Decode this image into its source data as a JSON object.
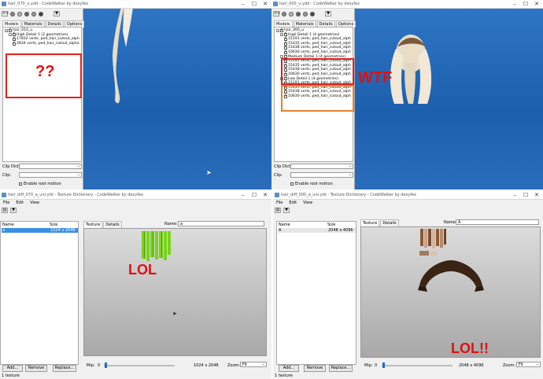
{
  "q1": {
    "title": "hair_070_u.ydd - CodeWalker by dexyfex",
    "tabs": [
      "Models",
      "Materials",
      "Details",
      "Options"
    ],
    "tree": [
      {
        "label": "hair_014_u",
        "checked": true,
        "indent": 0
      },
      {
        "label": "High Detail 1 (2 geometries)",
        "checked": true,
        "indent": 1
      },
      {
        "label": "17832 verts, ped_hair_cutout_alph",
        "checked": true,
        "indent": 2
      },
      {
        "label": "2834 verts, ped_hair_cutout_alpha",
        "checked": true,
        "indent": 2
      }
    ],
    "annotation": "??",
    "clip_dict_label": "Clip Dict:",
    "clip_label": "Clip:",
    "root_motion_label": "Enable root motion"
  },
  "q2": {
    "title": "hair_000_u.ydd - CodeWalker by dexyfex",
    "tabs": [
      "Models",
      "Materials",
      "Details",
      "Options"
    ],
    "tree": [
      {
        "label": "hair_005_u",
        "checked": true,
        "indent": 0
      },
      {
        "label": "High Detail 1 (4 geometries)",
        "checked": true,
        "indent": 1
      },
      {
        "label": "15191 verts, ped_hair_cutout_alph",
        "checked": true,
        "indent": 2
      },
      {
        "label": "15435 verts, ped_hair_cutout_alph",
        "checked": true,
        "indent": 2
      },
      {
        "label": "15438 verts, ped_hair_cutout_alph",
        "checked": true,
        "indent": 2
      },
      {
        "label": "10630 verts, ped_hair_cutout_alph",
        "checked": true,
        "indent": 2
      },
      {
        "label": "Medium Detail 1 (4 geometries)",
        "checked": false,
        "indent": 1
      },
      {
        "label": "15191 verts, ped_hair_cutout_alph",
        "checked": true,
        "indent": 2
      },
      {
        "label": "15435 verts, ped_hair_cutout_alph",
        "checked": true,
        "indent": 2
      },
      {
        "label": "15438 verts, ped_hair_cutout_alph",
        "checked": true,
        "indent": 2
      },
      {
        "label": "10630 verts, ped_hair_cutout_alph",
        "checked": true,
        "indent": 2
      },
      {
        "label": "Low Detail 1 (4 geometries)",
        "checked": false,
        "indent": 1
      },
      {
        "label": "15191 verts, ped_hair_cutout_alph",
        "checked": true,
        "indent": 2
      },
      {
        "label": "15435 verts, ped_hair_cutout_alph",
        "checked": true,
        "indent": 2
      },
      {
        "label": "15438 verts, ped_hair_cutout_alph",
        "checked": true,
        "indent": 2
      },
      {
        "label": "10630 verts, ped_hair_cutout_alph",
        "checked": true,
        "indent": 2
      }
    ],
    "annotation": "WTF",
    "clip_dict_label": "Clip Dict:",
    "clip_label": "Clip:",
    "root_motion_label": "Enable root motion"
  },
  "q3": {
    "title": "hair_diff_070_a_uni.ytd - Texture Dictionary - CodeWalker by dexyfex",
    "menu": [
      "File",
      "Edit",
      "View"
    ],
    "col_name": "Name",
    "col_size": "Size",
    "row_name": "a",
    "row_size": "1024 x 2048",
    "tabs": [
      "Texture",
      "Details"
    ],
    "name_label": "Name:",
    "name_value": "a",
    "annotation": "LOL",
    "mip_label": "Mip:",
    "mip_value": "0",
    "dims": "1024 x 2048",
    "zoom_label": "Zoom:",
    "zoom_value": "Fit",
    "btn_add": "Add...",
    "btn_remove": "Remove",
    "btn_replace": "Replace...",
    "status": "1 texture"
  },
  "q4": {
    "title": "hair_diff_000_a_uni.ytd - Texture Dictionary - CodeWalker by dexyfex",
    "menu": [
      "File",
      "Edit",
      "View"
    ],
    "col_name": "Name",
    "col_size": "Size",
    "row_name": "A",
    "row_size": "2048 x 4096",
    "tabs": [
      "Texture",
      "Details"
    ],
    "name_label": "Name:",
    "name_value": "A",
    "annotation": "LOL!!",
    "mip_label": "Mip:",
    "mip_value": "0",
    "dims": "2048 x 4096",
    "zoom_label": "Zoom:",
    "zoom_value": "Fit",
    "btn_add": "Add...",
    "btn_remove": "Remove",
    "btn_replace": "Replace...",
    "status": "1 texture"
  },
  "colors": {
    "annotation_red": "#e01010",
    "annotation_orange": "#e8802a",
    "viewport_blue": "#1f63b2",
    "selection_blue": "#3a8ee6"
  }
}
